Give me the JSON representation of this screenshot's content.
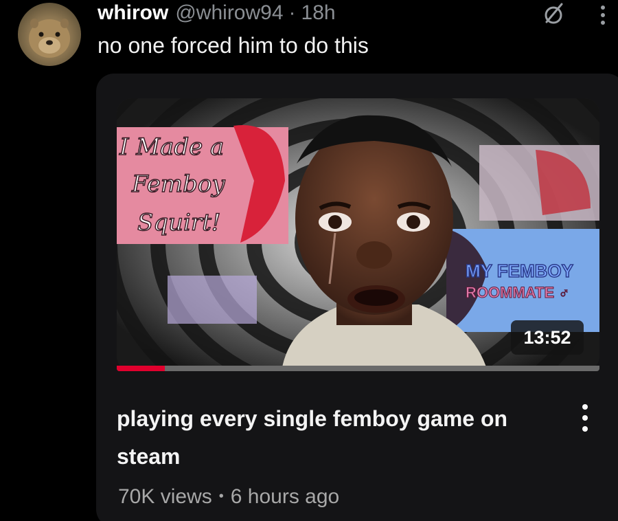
{
  "post": {
    "display_name": "whirow",
    "handle": "@whirow94",
    "separator": "·",
    "time_ago": "18h",
    "text": "no one forced him to do this"
  },
  "video": {
    "duration": "13:52",
    "progress_fraction": 0.1,
    "title": "playing every single femboy game on steam",
    "views": "70K views",
    "meta_separator": "•",
    "uploaded": "6 hours ago",
    "thumbnail_texts": {
      "left_card": [
        "I Made a",
        "Femboy",
        "Squirt!"
      ],
      "right_card": [
        "MY FEMBOY",
        "ROOMMATE ♂"
      ]
    }
  },
  "icons": {
    "avatar": "avatar-image",
    "mute": "mute-icon",
    "more_top": "more-vertical-icon",
    "more_video": "more-vertical-icon"
  },
  "colors": {
    "background": "#000000",
    "card": "#141416",
    "progress": "#e1002d",
    "muted_text": "#8b8f94"
  }
}
